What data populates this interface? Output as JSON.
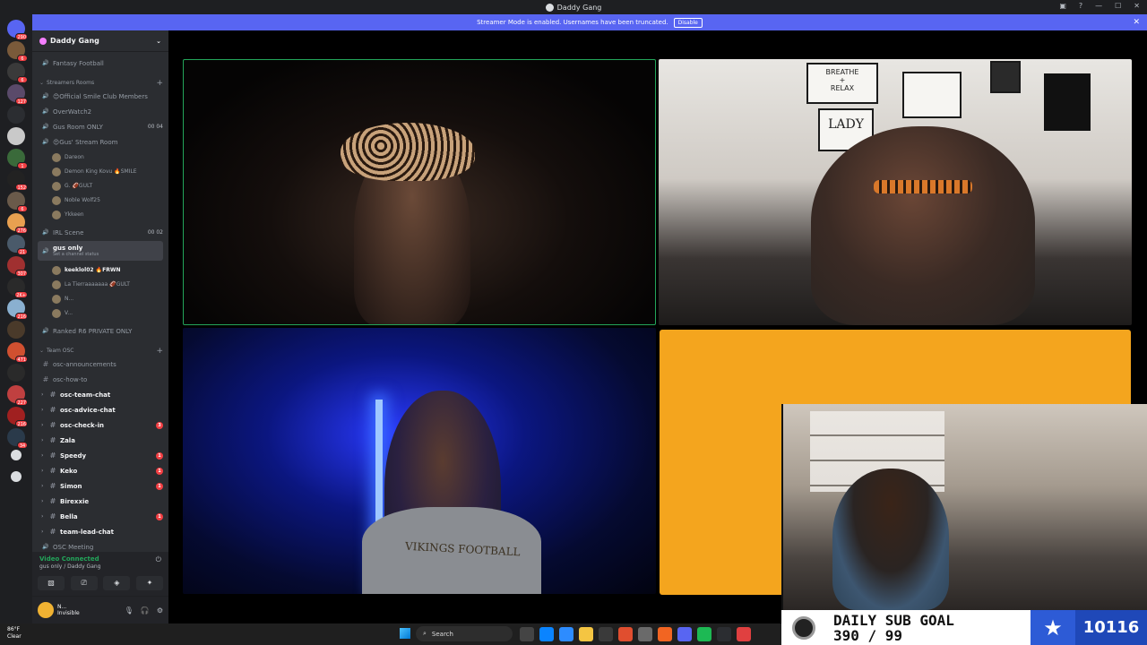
{
  "window": {
    "title": "Daddy Gang"
  },
  "banner": {
    "message": "Streamer Mode is enabled. Usernames have been truncated.",
    "disable_label": "Disable",
    "close": "✕"
  },
  "server_badges": [
    "290",
    "6",
    "6",
    "127",
    "",
    "",
    "1",
    "152",
    "6",
    "276",
    "21",
    "307",
    "2K+",
    "216",
    "",
    "471",
    "",
    "227",
    "216",
    "34"
  ],
  "sidebar": {
    "guild_name": "Daddy Gang",
    "rows": [
      {
        "label": "Fantasy Football",
        "type": "voice"
      },
      {
        "label": "Streamers Rooms",
        "type": "category"
      },
      {
        "label": "😊Official Smile Club Members",
        "type": "voice"
      },
      {
        "label": "OverWatch2",
        "type": "voice"
      },
      {
        "label": "Gus Room ONLY",
        "type": "voice",
        "right": "00 04"
      },
      {
        "label": "😍Gus' Stream Room",
        "type": "voice"
      },
      {
        "label": "Dareon",
        "type": "user"
      },
      {
        "label": "Demon King Kovu 🔥SMILE",
        "type": "user"
      },
      {
        "label": "G. 🏈GULT",
        "type": "user"
      },
      {
        "label": "Noble Wolf25",
        "type": "user"
      },
      {
        "label": "Ykkeen",
        "type": "user"
      },
      {
        "label": "IRL Scene",
        "type": "voice",
        "right": "00 02"
      },
      {
        "label": "gus only",
        "type": "voice-active",
        "sub": "Set a channel status"
      },
      {
        "label": "keeklol02 🔥FRWN",
        "type": "user-bright"
      },
      {
        "label": "La Tierraaaaaaa 🏈GULT",
        "type": "user"
      },
      {
        "label": "N...",
        "type": "user"
      },
      {
        "label": "V...",
        "type": "user"
      },
      {
        "label": "Ranked R6 PRIVATE ONLY",
        "type": "voice"
      },
      {
        "label": "Team OSC",
        "type": "category"
      },
      {
        "label": "osc-announcements",
        "type": "text"
      },
      {
        "label": "osc-how-to",
        "type": "text"
      },
      {
        "label": "osc-team-chat",
        "type": "text-bright"
      },
      {
        "label": "osc-advice-chat",
        "type": "text-bright"
      },
      {
        "label": "osc-check-in",
        "type": "text-bright",
        "badge": "3"
      },
      {
        "label": "Zala",
        "type": "text-bright"
      },
      {
        "label": "Speedy",
        "type": "text-bright",
        "badge": "1"
      },
      {
        "label": "Keko",
        "type": "text-bright",
        "badge": "1"
      },
      {
        "label": "Simon",
        "type": "text-bright",
        "badge": "1"
      },
      {
        "label": "Birexxie",
        "type": "text-bright"
      },
      {
        "label": "Bella",
        "type": "text-bright",
        "badge": "1"
      },
      {
        "label": "team-lead-chat",
        "type": "text-bright"
      },
      {
        "label": "OSC Meeting",
        "type": "voice"
      }
    ]
  },
  "voice_panel": {
    "status": "Video Connected",
    "location": "gus only / Daddy Gang"
  },
  "user_panel": {
    "name": "N...",
    "status": "Invisible"
  },
  "video": {
    "tile2_poster_text": [
      "BREATHE",
      "+",
      "RELAX",
      "LADY"
    ],
    "tile3_shirt_text": "VIKINGS FOOTBALL"
  },
  "sub_goal": {
    "title": "DAILY SUB GOAL",
    "progress": "390 / 99",
    "count": "10116"
  },
  "taskbar": {
    "temperature": "86°F",
    "condition": "Clear",
    "search_placeholder": "Search"
  },
  "colors": {
    "accent": "#5865f2",
    "speaking": "#23a55a",
    "goal_blue": "#1f48b8",
    "orange_tile": "#f4a51e"
  }
}
